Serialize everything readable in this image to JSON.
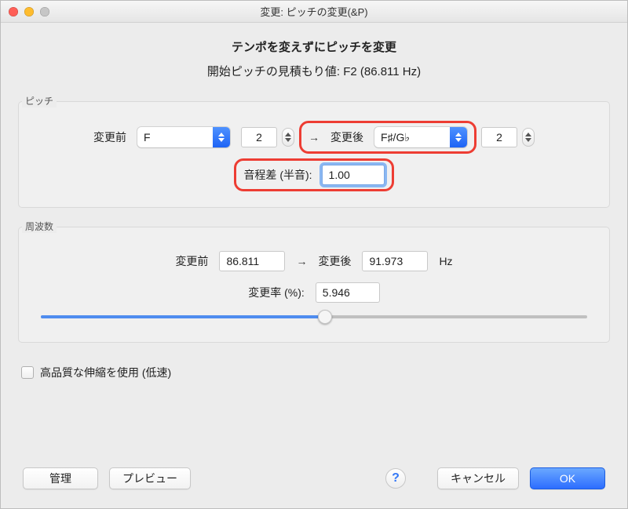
{
  "window": {
    "title": "変更: ピッチの変更(&P)"
  },
  "headings": {
    "line1": "テンポを変えずにピッチを変更",
    "line2": "開始ピッチの見積もり値: F2 (86.811 Hz)"
  },
  "pitch_group": {
    "label": "ピッチ",
    "from_label": "変更前",
    "from_note": "F",
    "from_octave": "2",
    "to_label": "変更後",
    "to_note": "F♯/G♭",
    "to_octave": "2",
    "arrow": "→",
    "semitone_label": "音程差 (半音):",
    "semitone_value": "1.00"
  },
  "freq_group": {
    "label": "周波数",
    "from_label": "変更前",
    "from_value": "86.811",
    "to_label": "変更後",
    "to_value": "91.973",
    "unit": "Hz",
    "arrow": "→",
    "percent_label": "変更率 (%):",
    "percent_value": "5.946",
    "slider_percent": 52
  },
  "hq": {
    "label": "高品質な伸縮を使用 (低速)",
    "checked": false
  },
  "buttons": {
    "manage": "管理",
    "preview": "プレビュー",
    "help": "?",
    "cancel": "キャンセル",
    "ok": "OK"
  }
}
